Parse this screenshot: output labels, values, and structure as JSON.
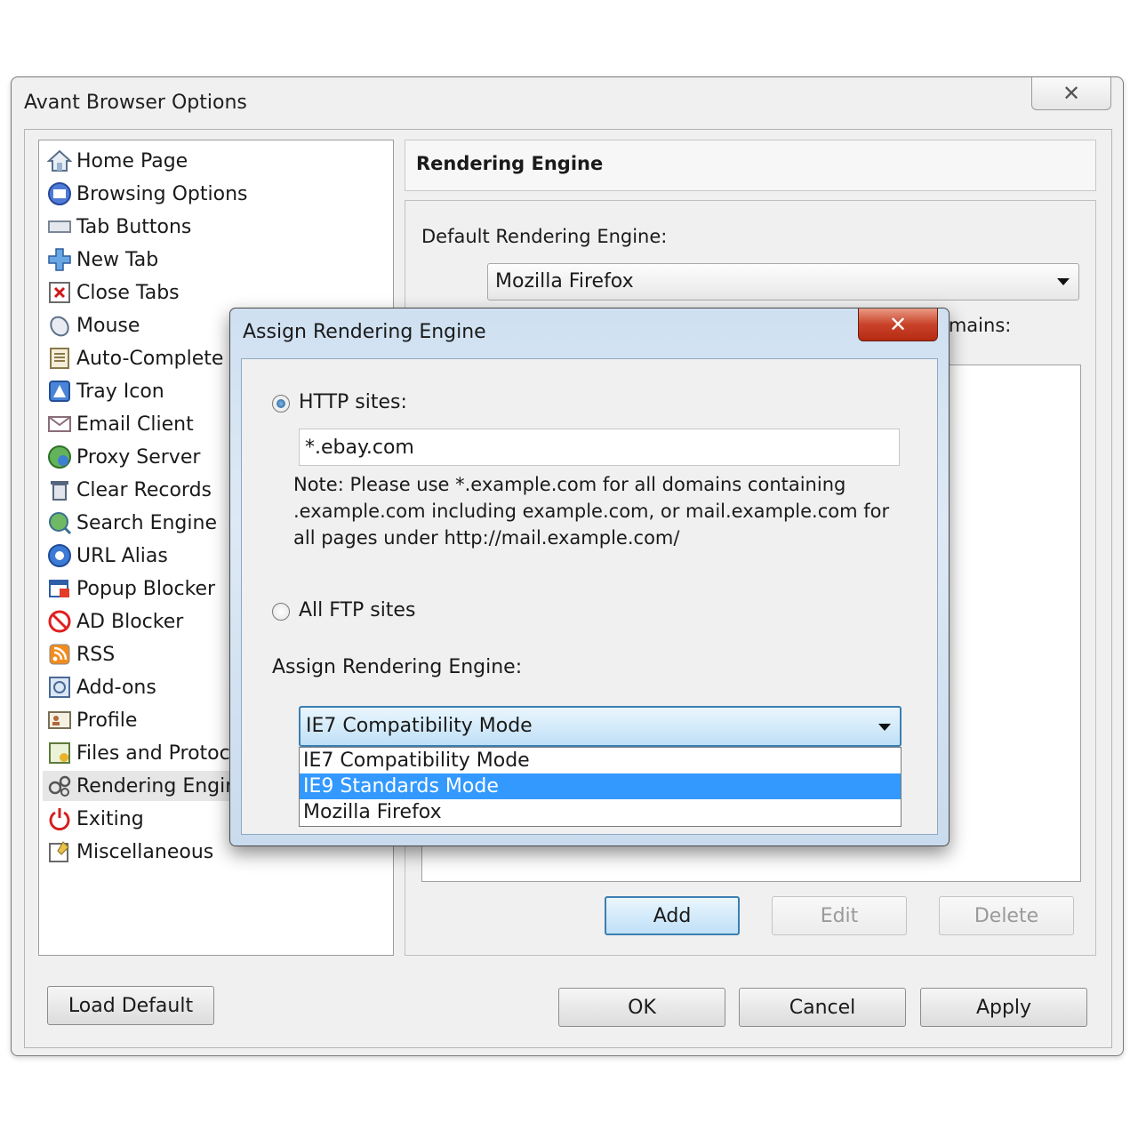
{
  "window": {
    "title": "Avant Browser Options",
    "close_glyph": "✕"
  },
  "sidebar": {
    "items": [
      {
        "label": "Home Page",
        "icon": "home-icon"
      },
      {
        "label": "Browsing Options",
        "icon": "browsing-options-icon"
      },
      {
        "label": "Tab Buttons",
        "icon": "tab-buttons-icon"
      },
      {
        "label": "New Tab",
        "icon": "plus-icon"
      },
      {
        "label": "Close Tabs",
        "icon": "close-tab-icon"
      },
      {
        "label": "Mouse",
        "icon": "mouse-icon"
      },
      {
        "label": "Auto-Complete",
        "icon": "auto-complete-icon"
      },
      {
        "label": "Tray Icon",
        "icon": "tray-icon"
      },
      {
        "label": "Email Client",
        "icon": "envelope-icon"
      },
      {
        "label": "Proxy Server",
        "icon": "globe-icon"
      },
      {
        "label": "Clear Records",
        "icon": "trash-icon"
      },
      {
        "label": "Search Engine",
        "icon": "search-globe-icon"
      },
      {
        "label": "URL Alias",
        "icon": "url-alias-icon"
      },
      {
        "label": "Popup Blocker",
        "icon": "popup-blocker-icon"
      },
      {
        "label": "AD Blocker",
        "icon": "no-sign-icon"
      },
      {
        "label": "RSS",
        "icon": "rss-icon"
      },
      {
        "label": "Add-ons",
        "icon": "add-ons-icon"
      },
      {
        "label": "Profile",
        "icon": "profile-icon"
      },
      {
        "label": "Files and Protoc",
        "icon": "files-icon"
      },
      {
        "label": "Rendering Engin",
        "icon": "gears-icon",
        "selected": true
      },
      {
        "label": "Exiting",
        "icon": "power-icon"
      },
      {
        "label": "Miscellaneous",
        "icon": "misc-icon"
      }
    ]
  },
  "panel": {
    "title": "Rendering Engine",
    "default_label": "Default Rendering Engine:",
    "default_value": "Mozilla Firefox",
    "domains_label": "omains:",
    "buttons": {
      "add": "Add",
      "edit": "Edit",
      "delete": "Delete"
    }
  },
  "footer": {
    "load_default": "Load Default",
    "ok": "OK",
    "cancel": "Cancel",
    "apply": "Apply"
  },
  "dialog": {
    "title": "Assign Rendering Engine",
    "close_glyph": "✕",
    "http_label": "HTTP sites:",
    "http_value": "*.ebay.com",
    "note": "Note: Please use *.example.com for all domains containing .example.com including example.com, or mail.example.com for all pages under http://mail.example.com/",
    "ftp_label": "All FTP sites",
    "assign_label": "Assign Rendering Engine:",
    "assign_value": "IE7 Compatibility Mode",
    "options": [
      "IE7 Compatibility Mode",
      "IE9 Standards Mode",
      "Mozilla Firefox"
    ],
    "highlighted_option": "IE9 Standards Mode"
  }
}
